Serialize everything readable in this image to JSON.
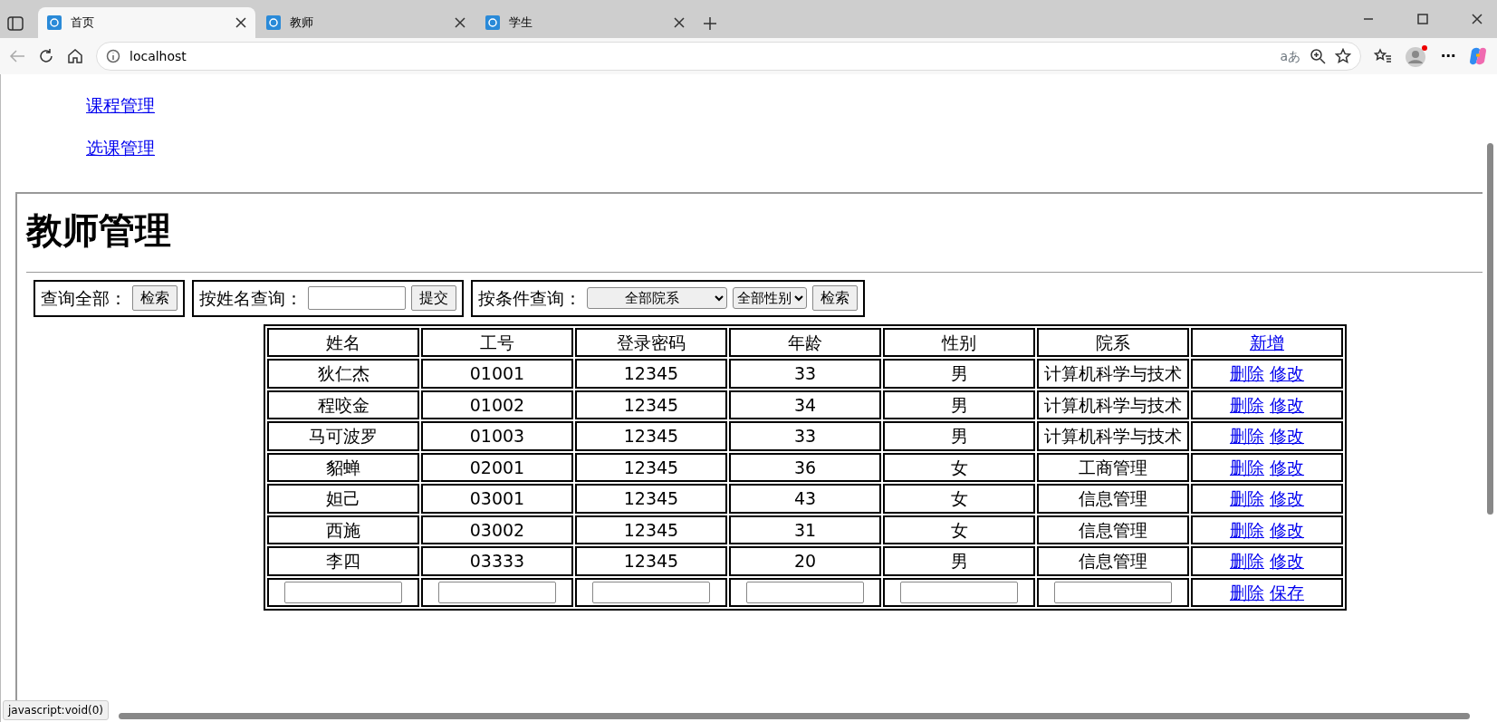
{
  "browser": {
    "tabs": [
      {
        "title": "首页",
        "selected": true
      },
      {
        "title": "教师",
        "selected": false
      },
      {
        "title": "学生",
        "selected": false
      }
    ],
    "address": "localhost",
    "translate_label": "aあ",
    "more_label": "⋯",
    "status_text": "javascript:void(0)"
  },
  "nav_links": [
    "课程管理",
    "选课管理"
  ],
  "heading": "教师管理",
  "query_groups": [
    {
      "kind": "all",
      "label": "查询全部：",
      "button": "检索"
    },
    {
      "kind": "name",
      "label": "按姓名查询：",
      "button": "提交"
    },
    {
      "kind": "filter",
      "label": "按条件查询：",
      "selects": [
        "全部院系",
        "全部性别"
      ],
      "button": "检索"
    }
  ],
  "table": {
    "columns": [
      "姓名",
      "工号",
      "登录密码",
      "年龄",
      "性别",
      "院系"
    ],
    "add_link": "新增",
    "rows": [
      {
        "cells": [
          "狄仁杰",
          "01001",
          "12345",
          "33",
          "男",
          "计算机科学与技术"
        ],
        "actions": [
          "删除",
          "修改"
        ]
      },
      {
        "cells": [
          "程咬金",
          "01002",
          "12345",
          "34",
          "男",
          "计算机科学与技术"
        ],
        "actions": [
          "删除",
          "修改"
        ]
      },
      {
        "cells": [
          "马可波罗",
          "01003",
          "12345",
          "33",
          "男",
          "计算机科学与技术"
        ],
        "actions": [
          "删除",
          "修改"
        ]
      },
      {
        "cells": [
          "貂蝉",
          "02001",
          "12345",
          "36",
          "女",
          "工商管理"
        ],
        "actions": [
          "删除",
          "修改"
        ]
      },
      {
        "cells": [
          "妲己",
          "03001",
          "12345",
          "43",
          "女",
          "信息管理"
        ],
        "actions": [
          "删除",
          "修改"
        ]
      },
      {
        "cells": [
          "西施",
          "03002",
          "12345",
          "31",
          "女",
          "信息管理"
        ],
        "actions": [
          "删除",
          "修改"
        ]
      },
      {
        "cells": [
          "李四",
          "03333",
          "12345",
          "20",
          "男",
          "信息管理"
        ],
        "actions": [
          "删除",
          "修改"
        ]
      }
    ],
    "new_row": {
      "actions": [
        "删除",
        "保存"
      ]
    }
  }
}
